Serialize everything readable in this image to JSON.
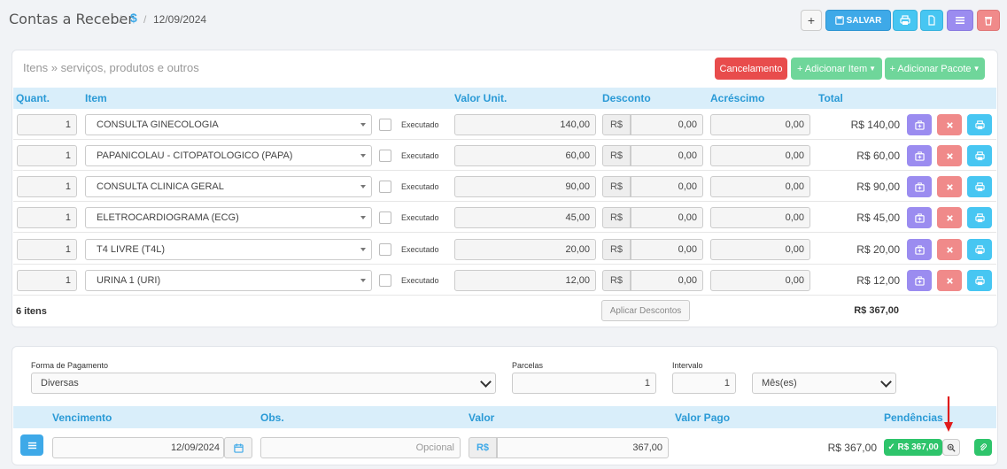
{
  "header": {
    "title": "Contas a Receber",
    "crumb_sep": "/",
    "currency_symbol": "$",
    "date": "12/09/2024",
    "save_label": "SALVAR",
    "add_label": "+"
  },
  "items_section": {
    "placeholder": "Itens » serviços, produtos e outros",
    "cancel_label": "Cancelamento",
    "add_item_label": "+ Adicionar Item",
    "add_package_label": "+ Adicionar Pacote",
    "columns": [
      "Quant.",
      "Item",
      "Valor Unit.",
      "Desconto",
      "Acréscimo",
      "Total"
    ],
    "executed_label": "Executado",
    "currency_prefix": "R$",
    "rows": [
      {
        "qty": "1",
        "item": "CONSULTA GINECOLOGIA",
        "unit": "140,00",
        "discount": "0,00",
        "addition": "0,00",
        "total": "R$ 140,00"
      },
      {
        "qty": "1",
        "item": "PAPANICOLAU - CITOPATOLOGICO (PAPA)",
        "unit": "60,00",
        "discount": "0,00",
        "addition": "0,00",
        "total": "R$ 60,00"
      },
      {
        "qty": "1",
        "item": "CONSULTA CLINICA GERAL",
        "unit": "90,00",
        "discount": "0,00",
        "addition": "0,00",
        "total": "R$ 90,00"
      },
      {
        "qty": "1",
        "item": "ELETROCARDIOGRAMA (ECG)",
        "unit": "45,00",
        "discount": "0,00",
        "addition": "0,00",
        "total": "R$ 45,00"
      },
      {
        "qty": "1",
        "item": "T4 LIVRE (T4L)",
        "unit": "20,00",
        "discount": "0,00",
        "addition": "0,00",
        "total": "R$ 20,00"
      },
      {
        "qty": "1",
        "item": "URINA 1 (URI)",
        "unit": "12,00",
        "discount": "0,00",
        "addition": "0,00",
        "total": "R$ 12,00"
      }
    ],
    "count_label": "6 itens",
    "apply_discounts_label": "Aplicar Descontos",
    "grand_total": "R$ 367,00"
  },
  "payment": {
    "method_label": "Forma de Pagamento",
    "method_value": "Diversas",
    "installments_label": "Parcelas",
    "installments_value": "1",
    "interval_label": "Intervalo",
    "interval_value": "1",
    "interval_unit": "Mês(es)",
    "columns": [
      "Vencimento",
      "Obs.",
      "Valor",
      "Valor Pago",
      "Pendências"
    ],
    "due_date": "12/09/2024",
    "obs_placeholder": "Opcional",
    "currency_prefix": "R$",
    "amount": "367,00",
    "paid_value": "R$ 367,00",
    "pending_badge": "✓ R$ 367,00"
  },
  "colors": {
    "save": "#3ea9e8",
    "print": "#47c6f2",
    "purple": "#9b8cf0",
    "red": "#f08a8a",
    "danger": "#e84c4c",
    "green": "#6fd69a",
    "green_dark": "#2ec46b",
    "header_blue": "#2a9ad6"
  }
}
